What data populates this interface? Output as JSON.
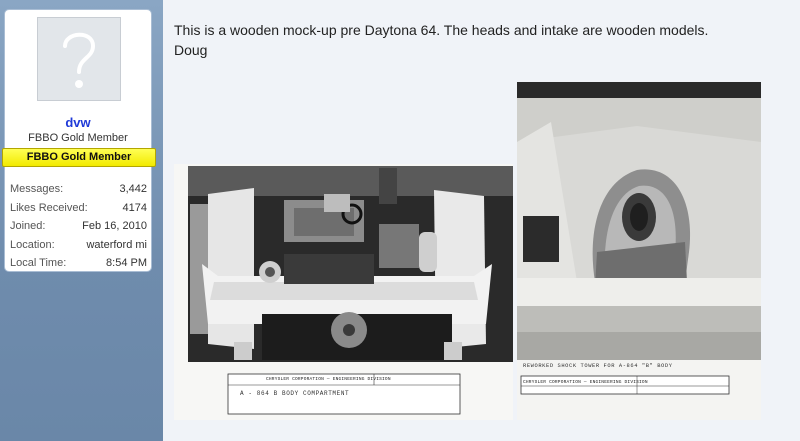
{
  "user": {
    "username": "dvw",
    "title": "FBBO Gold Member",
    "banner": "FBBO Gold Member",
    "avatar_icon": "question-mark-icon",
    "stats": [
      {
        "label": "Messages:",
        "value": "3,442"
      },
      {
        "label": "Likes Received:",
        "value": "4174"
      },
      {
        "label": "Joined:",
        "value": "Feb 16, 2010"
      },
      {
        "label": "Location:",
        "value": "waterford mi"
      },
      {
        "label": "Local Time:",
        "value": "8:54 PM"
      }
    ]
  },
  "post": {
    "lines": [
      "This is a wooden mock-up pre Daytona 64. The heads and intake are wooden models.",
      "Doug"
    ],
    "photos": [
      {
        "caption": "CHRYSLER CORPORATION — ENGINEERING DIVISION",
        "handwriting": "A - 864    B BODY    COMPARTMENT"
      },
      {
        "caption": "CHRYSLER CORPORATION — ENGINEERING DIVISION",
        "handwriting": "REWORKED SHOCK TOWER  FOR A-864 \"B\" BODY"
      }
    ]
  },
  "colors": {
    "sidebar": "#7893b2",
    "username": "#1f3ad8",
    "banner": "#f5ef00"
  }
}
